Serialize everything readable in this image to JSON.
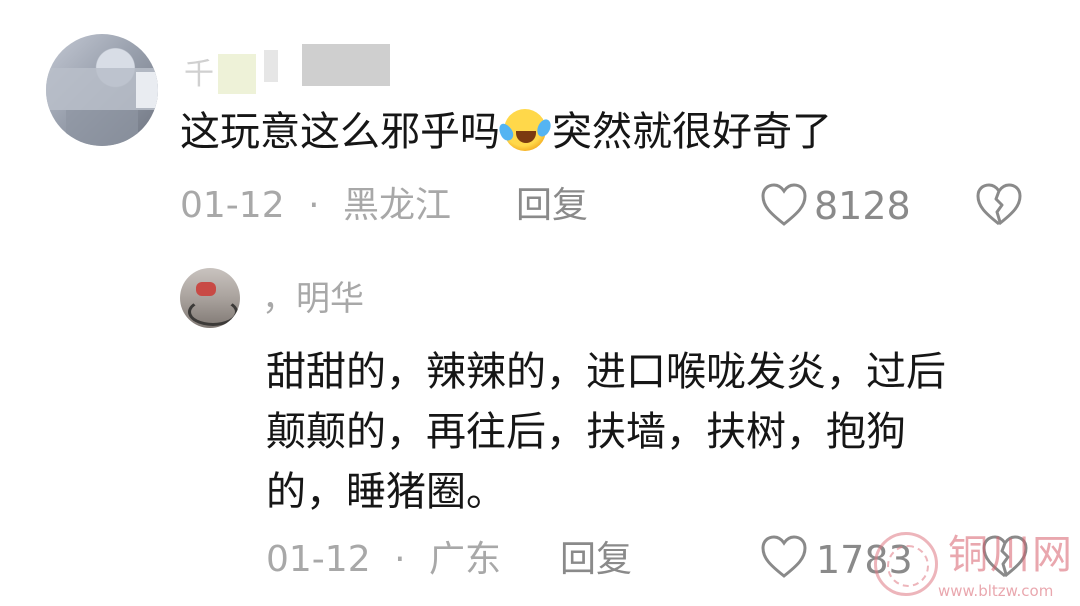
{
  "comments": [
    {
      "username_fragment": "千",
      "text_before_emoji": "这玩意这么邪乎吗",
      "emoji": "laughing-crying-emoji",
      "text_after_emoji": "突然就很好奇了",
      "date": "01-12",
      "separator": "·",
      "location": "黑龙江",
      "reply_label": "回复",
      "likes": "8128"
    }
  ],
  "reply": {
    "username": "，明华",
    "lines": [
      "甜甜的，辣辣的，进口喉咙发炎，过后",
      "颠颠的，再往后，扶墙，扶树，抱狗",
      "的，睡猪圈。"
    ],
    "date": "01-12",
    "separator": "·",
    "location": "广东",
    "reply_label": "回复",
    "likes": "1783"
  },
  "watermark": {
    "title": "铜川网",
    "url": "www.bltzw.com"
  },
  "colors": {
    "text": "#161616",
    "meta": "#a8a8a8",
    "watermark": "#d8606d"
  }
}
